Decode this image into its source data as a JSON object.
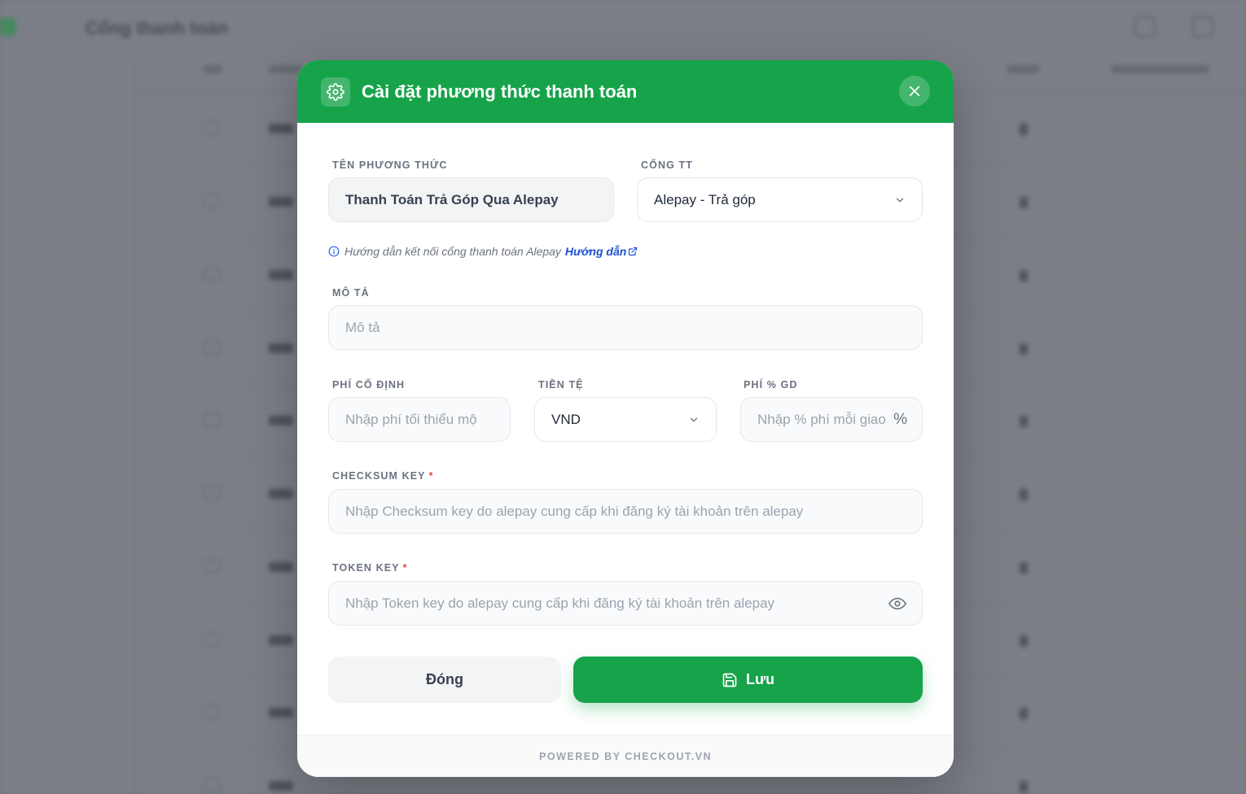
{
  "background": {
    "page_title": "Cổng thanh toán"
  },
  "modal": {
    "title": "Cài đặt phương thức thanh toán",
    "fields": {
      "method_name": {
        "label": "TÊN PHƯƠNG THỨC",
        "value": "Thanh Toán Trả Góp Qua Alepay"
      },
      "gateway": {
        "label": "CỔNG TT",
        "value": "Alepay - Trả góp"
      },
      "description": {
        "label": "MÔ TẢ",
        "placeholder": "Mô tả"
      },
      "fixed_fee": {
        "label": "PHÍ CỐ ĐỊNH",
        "placeholder": "Nhập phí tối thiểu mộ"
      },
      "currency": {
        "label": "TIỀN TỆ",
        "value": "VND"
      },
      "percent_fee": {
        "label": "PHÍ % GD",
        "placeholder": "Nhập % phí mỗi giao",
        "suffix": "%"
      },
      "checksum_key": {
        "label": "CHECKSUM KEY",
        "required_mark": "*",
        "placeholder": "Nhập Checksum key do alepay cung cấp khi đăng ký tài khoản trên alepay"
      },
      "token_key": {
        "label": "TOKEN KEY",
        "required_mark": "*",
        "placeholder": "Nhập Token key do alepay cung cấp khi đăng ký tài khoản trên alepay"
      }
    },
    "hint": {
      "text": "Hướng dẫn kết nối cổng thanh toán Alepay",
      "link": "Hướng dẫn"
    },
    "buttons": {
      "close": "Đóng",
      "save": "Lưu"
    },
    "footer": "POWERED BY CHECKOUT.VN"
  },
  "colors": {
    "primary": "#16a34a",
    "overlay": "#74777f",
    "link": "#1d4ed8",
    "required": "#ef4444"
  },
  "icons": [
    "gear-icon",
    "close-icon",
    "info-icon",
    "external-link-icon",
    "chevron-down-icon",
    "eye-icon",
    "save-icon"
  ]
}
